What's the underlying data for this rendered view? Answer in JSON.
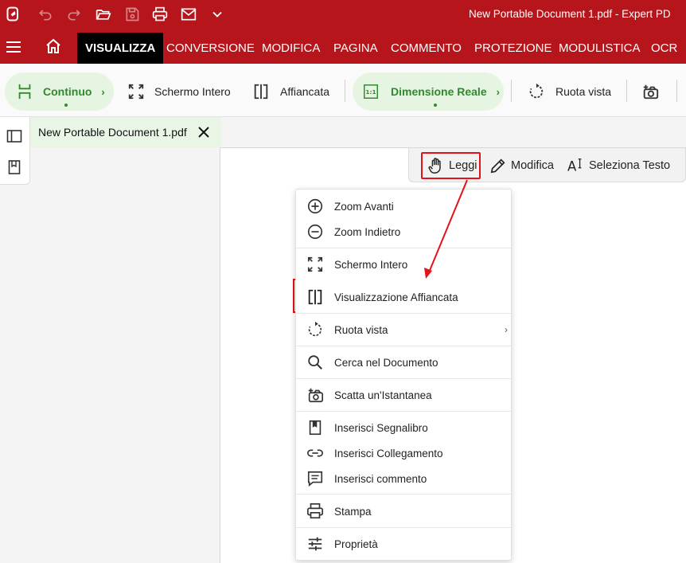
{
  "window": {
    "title": "New Portable Document 1.pdf   -   Expert PD",
    "quick_access": [
      "app-logo-icon",
      "undo-icon",
      "redo-icon",
      "open-folder-icon",
      "save-icon",
      "print-icon",
      "email-icon",
      "chevron-down-icon"
    ]
  },
  "ribbon": {
    "tabs": [
      {
        "label": "VISUALIZZA",
        "active": true
      },
      {
        "label": "CONVERSIONE",
        "active": false
      },
      {
        "label": "MODIFICA",
        "active": false
      },
      {
        "label": "PAGINA",
        "active": false
      },
      {
        "label": "COMMENTO",
        "active": false
      },
      {
        "label": "PROTEZIONE",
        "active": false
      },
      {
        "label": "MODULISTICA",
        "active": false
      },
      {
        "label": "OCR",
        "active": false
      }
    ]
  },
  "toolbar": {
    "continuo": "Continuo",
    "schermo_intero": "Schermo Intero",
    "affiancata": "Affiancata",
    "dimensione_reale": "Dimensione Reale",
    "ruota_vista": "Ruota vista"
  },
  "document_tab": {
    "name": "New Portable Document 1.pdf"
  },
  "modes": {
    "leggi": "Leggi",
    "modifica": "Modifica",
    "seleziona_testo": "Seleziona Testo"
  },
  "context_menu": {
    "zoom_avanti": "Zoom Avanti",
    "zoom_indietro": "Zoom Indietro",
    "schermo_intero": "Schermo Intero",
    "visualizzazione_affiancata": "Visualizzazione Affiancata",
    "ruota_vista": "Ruota vista",
    "cerca": "Cerca nel Documento",
    "istantanea": "Scatta un'Istantanea",
    "segnalibro": "Inserisci Segnalibro",
    "collegamento": "Inserisci Collegamento",
    "commento": "Inserisci commento",
    "stampa": "Stampa",
    "proprieta": "Proprietà"
  },
  "colors": {
    "brand_red": "#b5151b",
    "accent_green": "#2f8a2d",
    "highlight_red": "#e4121b"
  }
}
